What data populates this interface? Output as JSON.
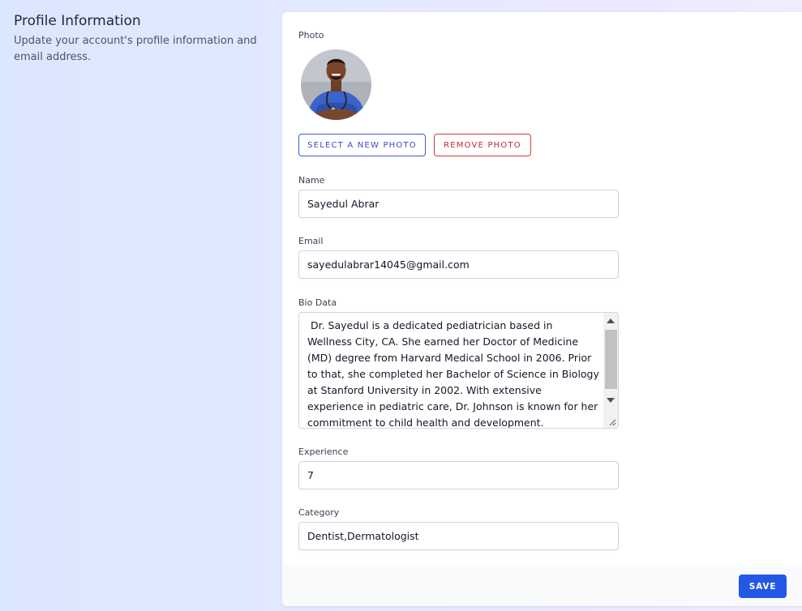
{
  "section": {
    "title": "Profile Information",
    "description": "Update your account's profile information and email address."
  },
  "photo": {
    "label": "Photo",
    "select_button": "SELECT A NEW PHOTO",
    "remove_button": "REMOVE PHOTO"
  },
  "name": {
    "label": "Name",
    "value": "Sayedul Abrar"
  },
  "email": {
    "label": "Email",
    "value": "sayedulabrar14045@gmail.com"
  },
  "bio": {
    "label": "Bio Data",
    "value": " Dr. Sayedul is a dedicated pediatrician based in Wellness City, CA. She earned her Doctor of Medicine (MD) degree from Harvard Medical School in 2006. Prior to that, she completed her Bachelor of Science in Biology at Stanford University in 2002. With extensive experience in pediatric care, Dr. Johnson is known for her commitment to child health and development."
  },
  "experience": {
    "label": "Experience",
    "value": "7"
  },
  "category": {
    "label": "Category",
    "value": "Dentist,Dermatologist"
  },
  "footer": {
    "save_label": "SAVE"
  },
  "colors": {
    "primary": "#2357e6",
    "danger": "#c62828",
    "outline_blue": "#3b5bdb"
  }
}
